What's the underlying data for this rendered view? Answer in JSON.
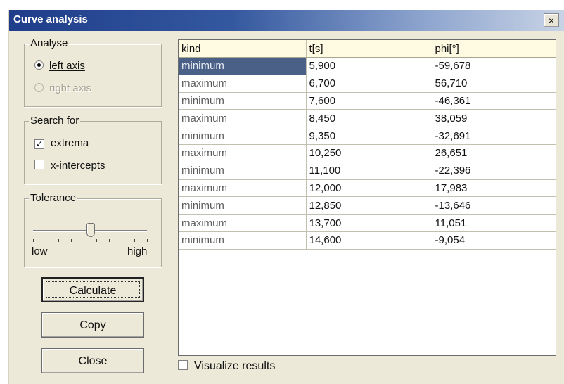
{
  "window": {
    "title": "Curve analysis",
    "close_glyph": "×"
  },
  "analyse": {
    "legend": "Analyse",
    "options": [
      {
        "label": "left axis",
        "selected": true,
        "enabled": true
      },
      {
        "label": "right axis",
        "selected": false,
        "enabled": false
      }
    ]
  },
  "search": {
    "legend": "Search for",
    "options": [
      {
        "label": "extrema",
        "checked": true
      },
      {
        "label": "x-intercepts",
        "checked": false
      }
    ]
  },
  "tolerance": {
    "legend": "Tolerance",
    "low_label": "low",
    "high_label": "high",
    "value_fraction": 0.55
  },
  "buttons": {
    "calculate": "Calculate",
    "copy": "Copy",
    "close": "Close"
  },
  "table": {
    "columns": [
      "kind",
      "t[s]",
      "phi[°]"
    ],
    "rows": [
      [
        "minimum",
        "5,900",
        "-59,678"
      ],
      [
        "maximum",
        "6,700",
        "56,710"
      ],
      [
        "minimum",
        "7,600",
        "-46,361"
      ],
      [
        "maximum",
        "8,450",
        "38,059"
      ],
      [
        "minimum",
        "9,350",
        "-32,691"
      ],
      [
        "maximum",
        "10,250",
        "26,651"
      ],
      [
        "minimum",
        "11,100",
        "-22,396"
      ],
      [
        "maximum",
        "12,000",
        "17,983"
      ],
      [
        "minimum",
        "12,850",
        "-13,646"
      ],
      [
        "maximum",
        "13,700",
        "11,051"
      ],
      [
        "minimum",
        "14,600",
        "-9,054"
      ]
    ],
    "selected_row": 0
  },
  "visualize": {
    "label": "Visualize results",
    "checked": false
  },
  "colors": {
    "selection": "#4a6086",
    "header_bg": "#fffbe3",
    "dialog_bg": "#ece9d8"
  }
}
